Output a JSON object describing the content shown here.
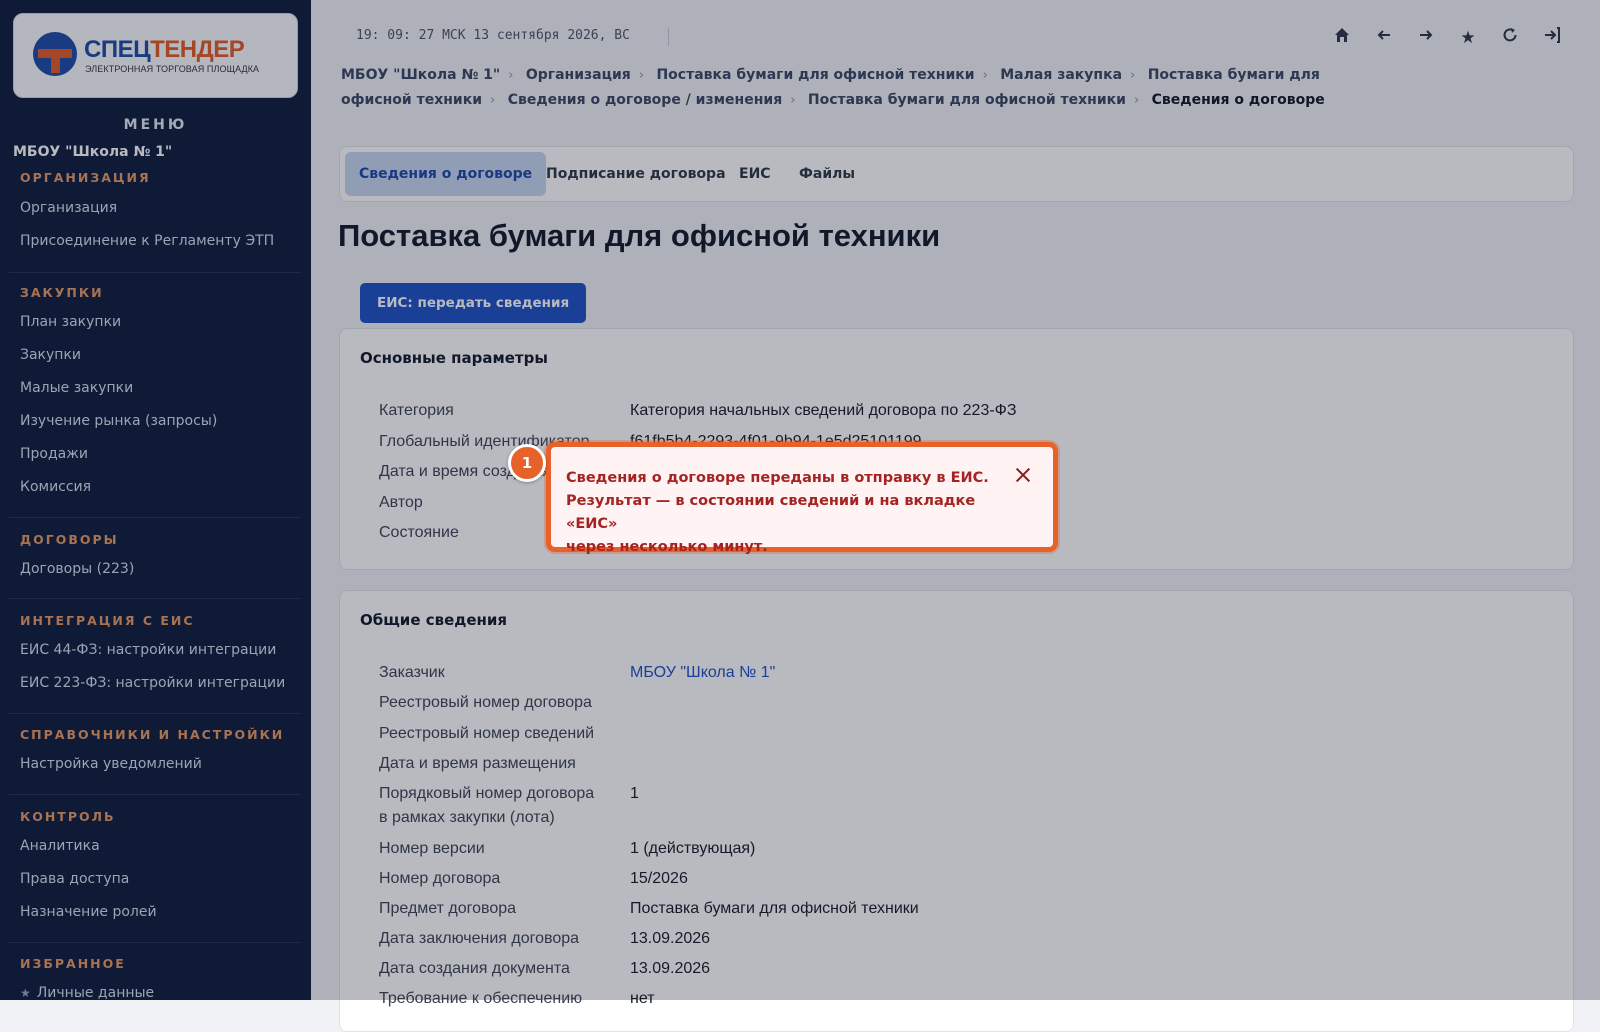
{
  "logo": {
    "word_a": "СПЕЦ",
    "word_b": "ТЕНДЕР",
    "subtitle": "ЭЛЕКТРОННАЯ ТОРГОВАЯ ПЛОЩАДКА"
  },
  "sidebar": {
    "menu_title": "МЕНЮ",
    "org_name": "МБОУ \"Школа № 1\"",
    "sections": [
      {
        "title": "ОРГАНИЗАЦИЯ",
        "items": [
          "Организация",
          "Присоединение к Регламенту ЭТП"
        ]
      },
      {
        "title": "ЗАКУПКИ",
        "items": [
          "План закупки",
          "Закупки",
          "Малые закупки",
          "Изучение рынка (запросы)",
          "Продажи",
          "Комиссия"
        ]
      },
      {
        "title": "ДОГОВОРЫ",
        "items": [
          "Договоры (223)"
        ]
      },
      {
        "title": "ИНТЕГРАЦИЯ С ЕИС",
        "items": [
          "ЕИС 44-ФЗ: настройки интеграции",
          "ЕИС 223-ФЗ: настройки интеграции"
        ]
      },
      {
        "title": "СПРАВОЧНИКИ И НАСТРОЙКИ",
        "items": [
          "Настройка уведомлений"
        ]
      },
      {
        "title": "КОНТРОЛЬ",
        "items": [
          "Аналитика",
          "Права доступа",
          "Назначение ролей"
        ]
      },
      {
        "title": "ИЗБРАННОЕ",
        "items": [
          "Личные данные"
        ]
      }
    ]
  },
  "topbar": {
    "clock": "19: 09: 27 МСК  13 сентября 2026, ВС",
    "icons": [
      "home-icon",
      "arrow-left-icon",
      "arrow-right-icon",
      "star-icon",
      "refresh-icon",
      "logout-icon"
    ]
  },
  "breadcrumbs": [
    "МБОУ \"Школа № 1\"",
    "Организация",
    "Поставка бумаги для офисной техники",
    "Малая закупка",
    "Поставка бумаги для офисной техники",
    "Сведения о договоре / изменения",
    "Поставка бумаги для офисной техники",
    "Сведения о договоре"
  ],
  "tabs": [
    "Сведения о договоре",
    "Подписание договора",
    "ЕИС",
    "Файлы"
  ],
  "active_tab": 0,
  "page_title": "Поставка бумаги для офисной техники",
  "eis_button": "ЕИС: передать сведения",
  "main_params": {
    "title": "Основные параметры",
    "rows": [
      {
        "label": "Категория",
        "value": "Категория начальных сведений договора по 223-ФЗ"
      },
      {
        "label": "Глобальный идентификатор",
        "value": "f61fb5b4-2293-4f01-9b94-1e5d25101199"
      },
      {
        "label": "Дата и время создания",
        "value": ""
      },
      {
        "label": "Автор",
        "value": ""
      },
      {
        "label": "Состояние",
        "value": ""
      }
    ]
  },
  "general_info": {
    "title": "Общие сведения",
    "rows": [
      {
        "label": "Заказчик",
        "value": "МБОУ \"Школа № 1\""
      },
      {
        "label": "Реестровый номер договора",
        "value": ""
      },
      {
        "label": "Реестровый номер сведений",
        "value": ""
      },
      {
        "label": "Дата и время размещения",
        "value": ""
      },
      {
        "label": "Порядковый номер договора",
        "label2": "в рамках закупки (лота)",
        "value": "1"
      },
      {
        "label": "Номер версии",
        "value": "1 (действующая)"
      },
      {
        "label": "Номер договора",
        "value": "15/2026"
      },
      {
        "label": "Предмет договора",
        "value": "Поставка бумаги для офисной техники"
      },
      {
        "label": "Дата заключения договора",
        "value": "13.09.2026"
      },
      {
        "label": "Дата создания документа",
        "value": "13.09.2026"
      },
      {
        "label": "Требование к обеспечению",
        "value": "нет"
      }
    ]
  },
  "toast": {
    "badge": "1",
    "line1": "Сведения о договоре переданы в отправку в ЕИС.",
    "line2": "Результат — в состоянии сведений и на вкладке «ЕИС»",
    "line3": "через несколько минут."
  }
}
